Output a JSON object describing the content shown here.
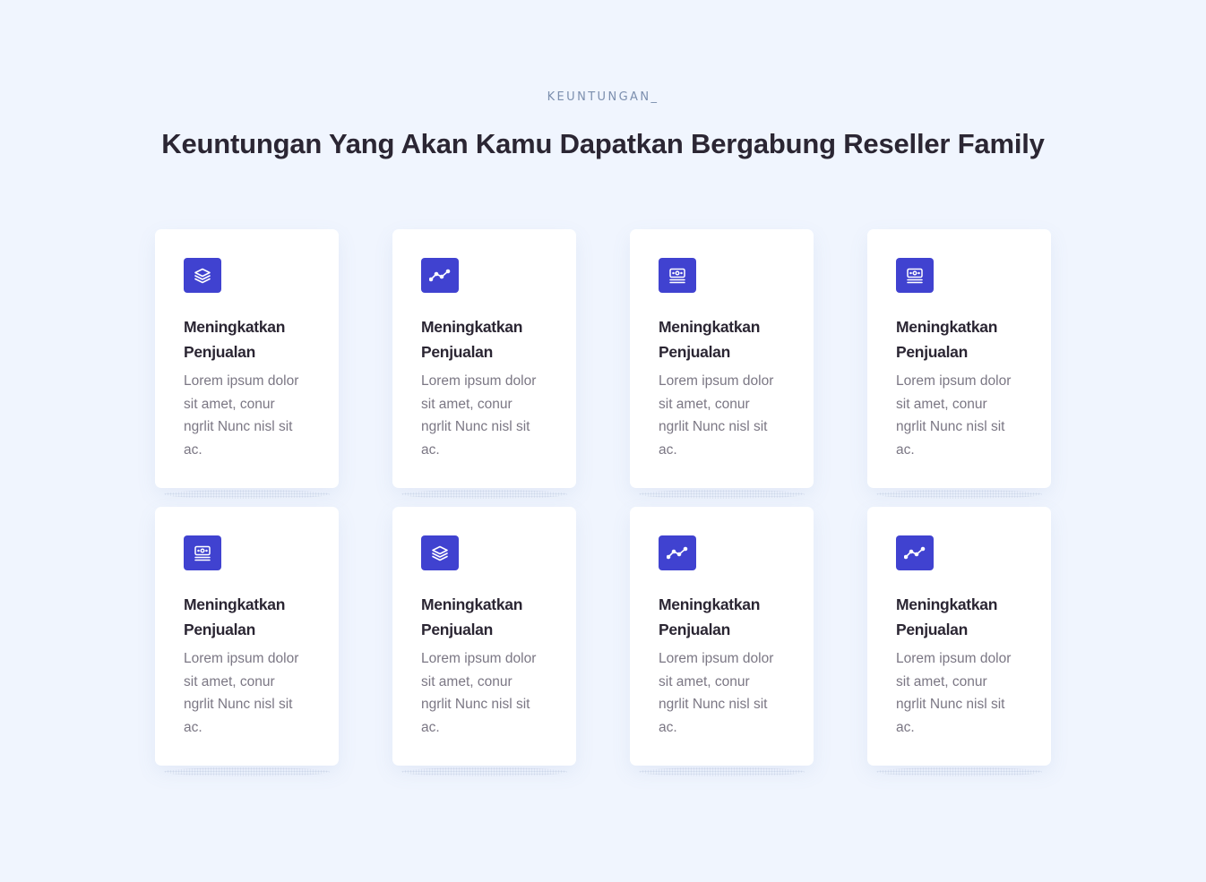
{
  "section": {
    "eyebrow": "KEUNTUNGAN_",
    "headline": "Keuntungan Yang Akan Kamu Dapatkan Bergabung Reseller Family"
  },
  "accent_color": "#4042d0",
  "cards": [
    {
      "icon": "layers-icon",
      "title_line1": "Meningkatkan",
      "title_line2": "Penjualan",
      "desc_lines": [
        "Lorem ipsum dolor",
        "sit amet, conur",
        "ngrlit Nunc nisl sit",
        "ac."
      ]
    },
    {
      "icon": "trend-line-icon",
      "title_line1": "Meningkatkan",
      "title_line2": "Penjualan",
      "desc_lines": [
        "Lorem ipsum dolor",
        "sit amet, conur",
        "ngrlit Nunc nisl sit",
        "ac."
      ]
    },
    {
      "icon": "money-stack-icon",
      "title_line1": "Meningkatkan",
      "title_line2": "Penjualan",
      "desc_lines": [
        "Lorem ipsum dolor",
        "sit amet, conur",
        "ngrlit Nunc nisl sit",
        "ac."
      ]
    },
    {
      "icon": "money-stack-icon",
      "title_line1": "Meningkatkan",
      "title_line2": "Penjualan",
      "desc_lines": [
        "Lorem ipsum dolor",
        "sit amet, conur",
        "ngrlit Nunc nisl sit",
        "ac."
      ]
    },
    {
      "icon": "money-stack-icon",
      "title_line1": "Meningkatkan",
      "title_line2": "Penjualan",
      "desc_lines": [
        "Lorem ipsum dolor",
        "sit amet, conur",
        "ngrlit Nunc nisl sit",
        "ac."
      ]
    },
    {
      "icon": "layers-icon",
      "title_line1": "Meningkatkan",
      "title_line2": "Penjualan",
      "desc_lines": [
        "Lorem ipsum dolor",
        "sit amet, conur",
        "ngrlit Nunc nisl sit",
        "ac."
      ]
    },
    {
      "icon": "trend-line-icon",
      "title_line1": "Meningkatkan",
      "title_line2": "Penjualan",
      "desc_lines": [
        "Lorem ipsum dolor",
        "sit amet, conur",
        "ngrlit Nunc nisl sit",
        "ac."
      ]
    },
    {
      "icon": "trend-line-icon",
      "title_line1": "Meningkatkan",
      "title_line2": "Penjualan",
      "desc_lines": [
        "Lorem ipsum dolor",
        "sit amet, conur",
        "ngrlit Nunc nisl sit",
        "ac."
      ]
    }
  ]
}
